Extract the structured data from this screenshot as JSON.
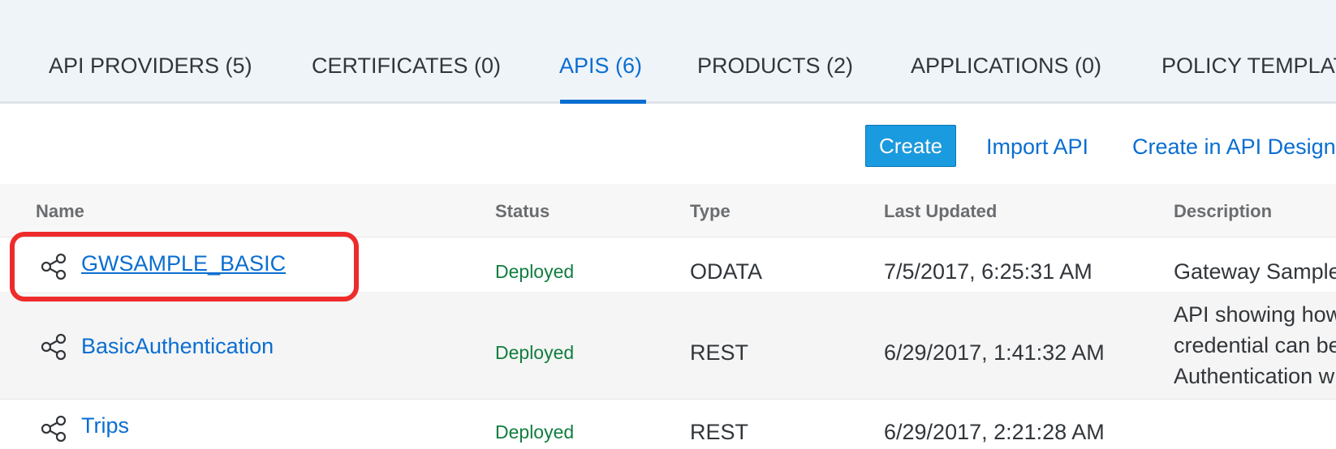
{
  "tabs": [
    {
      "label": "API PROVIDERS (5)"
    },
    {
      "label": "CERTIFICATES (0)"
    },
    {
      "label": "APIS (6)",
      "active": true
    },
    {
      "label": "PRODUCTS (2)"
    },
    {
      "label": "APPLICATIONS (0)"
    },
    {
      "label": "POLICY TEMPLATES"
    }
  ],
  "toolbar": {
    "create_label": "Create",
    "import_label": "Import API",
    "designer_label": "Create in API Designer"
  },
  "table": {
    "columns": [
      "Name",
      "Status",
      "Type",
      "Last Updated",
      "Description"
    ],
    "rows": [
      {
        "name": "GWSAMPLE_BASIC",
        "status": "Deployed",
        "type": "ODATA",
        "updated": "7/5/2017, 6:25:31 AM",
        "description": [
          "Gateway Sample"
        ]
      },
      {
        "name": "BasicAuthentication",
        "status": "Deployed",
        "type": "REST",
        "updated": "6/29/2017, 1:41:32 AM",
        "description": [
          "API showing how",
          "credential can be",
          "Authentication w"
        ]
      },
      {
        "name": "Trips",
        "status": "Deployed",
        "type": "REST",
        "updated": "6/29/2017, 2:21:28 AM",
        "description": []
      }
    ]
  },
  "colors": {
    "accent": "#0a6ed1",
    "status_deployed": "#107e3e",
    "highlight": "#ee2b2b",
    "button_bg": "#1a9be0"
  },
  "icons": {
    "row_icon": "share-icon"
  }
}
